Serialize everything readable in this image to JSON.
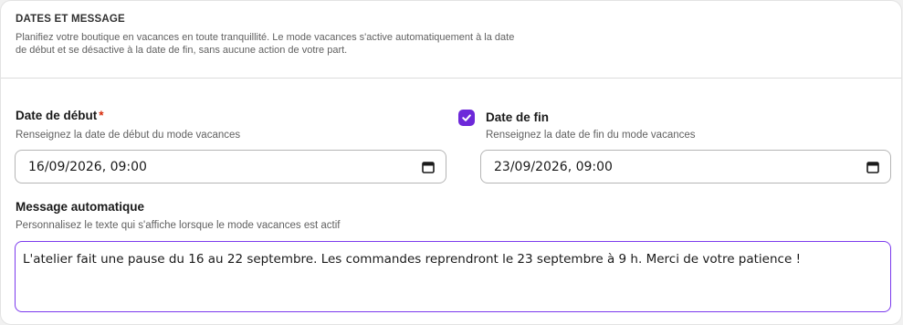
{
  "section": {
    "title": "DATES ET MESSAGE",
    "description": "Planifiez votre boutique en vacances en toute tranquillité. Le mode vacances s'active automatiquement à la date de début et se désactive à la date de fin, sans aucune action de votre part."
  },
  "start_date": {
    "label": "Date de début",
    "required_marker": "*",
    "help": "Renseignez la date de début du mode vacances",
    "value": "16/09/2026, 09:00",
    "icon": "calendar-icon"
  },
  "end_date": {
    "enabled": true,
    "label": "Date de fin",
    "help": "Renseignez la date de fin du mode vacances",
    "value": "23/09/2026, 09:00",
    "icon": "calendar-icon"
  },
  "message": {
    "label": "Message automatique",
    "help": "Personnalisez le texte qui s'affiche lorsque le mode vacances est actif",
    "value": "L'atelier fait une pause du 16 au 22 septembre. Les commandes reprendront le 23 septembre à 9 h. Merci de votre patience !"
  },
  "colors": {
    "accent": "#6d28d9",
    "required": "#d72c0d",
    "focus_border": "#7c3aed"
  }
}
